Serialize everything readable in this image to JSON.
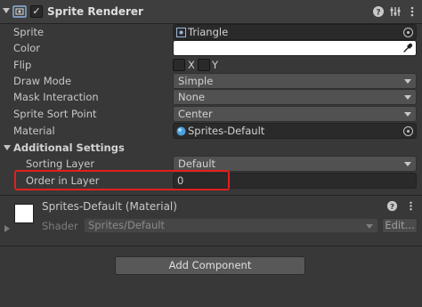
{
  "header": {
    "title": "Sprite Renderer",
    "enabled": true,
    "icons": [
      "sprite-renderer-icon",
      "help-icon",
      "preset-icon",
      "more-icon"
    ]
  },
  "properties": {
    "sprite": {
      "label": "Sprite",
      "value": "Triangle"
    },
    "color": {
      "label": "Color",
      "value": "#ffffff"
    },
    "flip": {
      "label": "Flip",
      "x_label": "X",
      "y_label": "Y"
    },
    "draw_mode": {
      "label": "Draw Mode",
      "value": "Simple"
    },
    "mask_interaction": {
      "label": "Mask Interaction",
      "value": "None"
    },
    "sort_point": {
      "label": "Sprite Sort Point",
      "value": "Center"
    },
    "material": {
      "label": "Material",
      "value": "Sprites-Default"
    }
  },
  "additional": {
    "label": "Additional Settings",
    "sorting_layer": {
      "label": "Sorting Layer",
      "value": "Default"
    },
    "order_in_layer": {
      "label": "Order in Layer",
      "value": "0"
    }
  },
  "material_panel": {
    "title": "Sprites-Default (Material)",
    "shader_label": "Shader",
    "shader_value": "Sprites/Default",
    "edit_label": "Edit..."
  },
  "add_component": {
    "label": "Add Component"
  },
  "colors": {
    "highlight": "#e2201c",
    "panel": "#383838",
    "header": "#3e3e3e",
    "accent_blue": "#4aa3df"
  }
}
